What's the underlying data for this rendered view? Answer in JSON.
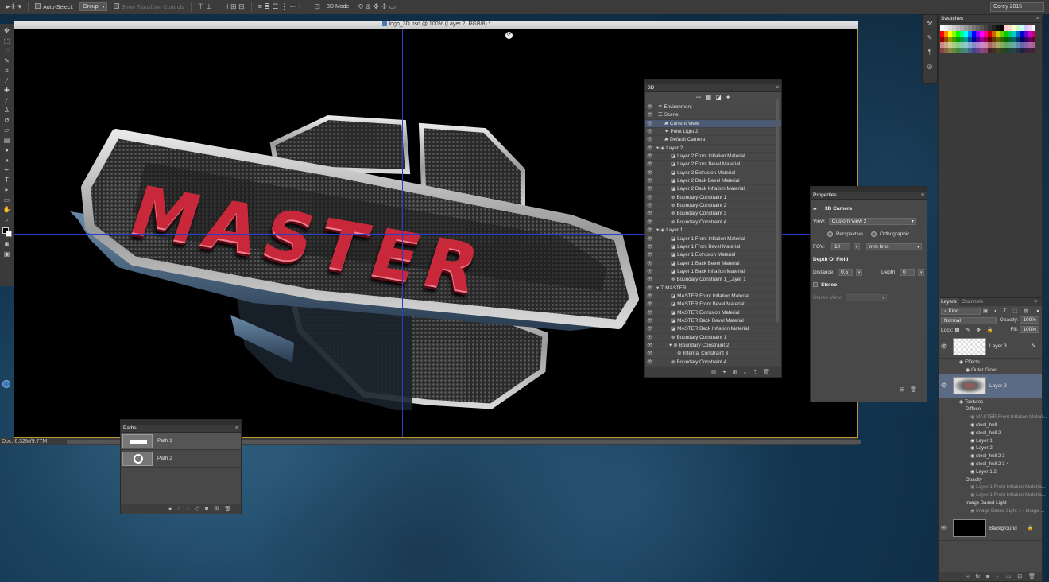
{
  "options_bar": {
    "auto_select_label": "Auto-Select:",
    "auto_select_value": "Group",
    "transform_controls_label": "Show Transform Controls",
    "mode_3d_label": "3D Mode:",
    "workspace": "Corey 2015"
  },
  "document": {
    "tab_title": "logo_3D.psd @ 100% (Layer 2, RGB/8) *",
    "logo_text": "MASTER",
    "status_doc": "Doc: 6.32M/9.77M"
  },
  "panel_3d": {
    "title": "3D",
    "rows": [
      {
        "label": "Environment",
        "indent": 0,
        "glyph": "✲",
        "twisty": ""
      },
      {
        "label": "Scene",
        "indent": 0,
        "glyph": "☰",
        "twisty": ""
      },
      {
        "label": "Current View",
        "indent": 1,
        "glyph": "▰",
        "twisty": "",
        "selected": true
      },
      {
        "label": "Point Light 2",
        "indent": 1,
        "glyph": "✦",
        "twisty": ""
      },
      {
        "label": "Default Camera",
        "indent": 1,
        "glyph": "▰",
        "twisty": ""
      },
      {
        "label": "Layer 2",
        "indent": 0,
        "glyph": "◈",
        "twisty": "▾"
      },
      {
        "label": "Layer 2 Front Inflation Material",
        "indent": 2,
        "glyph": "◪",
        "twisty": ""
      },
      {
        "label": "Layer 2 Front Bevel Material",
        "indent": 2,
        "glyph": "◪",
        "twisty": ""
      },
      {
        "label": "Layer 2 Extrusion Material",
        "indent": 2,
        "glyph": "◪",
        "twisty": ""
      },
      {
        "label": "Layer 2 Back Bevel Material",
        "indent": 2,
        "glyph": "◪",
        "twisty": ""
      },
      {
        "label": "Layer 2 Back Inflation Material",
        "indent": 2,
        "glyph": "◪",
        "twisty": ""
      },
      {
        "label": "Boundary Constraint 1",
        "indent": 2,
        "glyph": "⊗",
        "twisty": ""
      },
      {
        "label": "Boundary Constraint 2",
        "indent": 2,
        "glyph": "⊗",
        "twisty": ""
      },
      {
        "label": "Boundary Constraint 3",
        "indent": 2,
        "glyph": "⊗",
        "twisty": ""
      },
      {
        "label": "Boundary Constraint 4",
        "indent": 2,
        "glyph": "⊗",
        "twisty": ""
      },
      {
        "label": "Layer 1",
        "indent": 0,
        "glyph": "◈",
        "twisty": "▾"
      },
      {
        "label": "Layer 1 Front Inflation Material",
        "indent": 2,
        "glyph": "◪",
        "twisty": ""
      },
      {
        "label": "Layer 1 Front Bevel Material",
        "indent": 2,
        "glyph": "◪",
        "twisty": ""
      },
      {
        "label": "Layer 1 Extrusion Material",
        "indent": 2,
        "glyph": "◪",
        "twisty": ""
      },
      {
        "label": "Layer 1 Back Bevel Material",
        "indent": 2,
        "glyph": "◪",
        "twisty": ""
      },
      {
        "label": "Layer 1 Back Inflation Material",
        "indent": 2,
        "glyph": "◪",
        "twisty": ""
      },
      {
        "label": "Boundary Constraint 1_Layer 1",
        "indent": 2,
        "glyph": "⊗",
        "twisty": ""
      },
      {
        "label": "MASTER",
        "indent": 0,
        "glyph": "T",
        "twisty": "▾"
      },
      {
        "label": "MASTER Front Inflation Material",
        "indent": 2,
        "glyph": "◪",
        "twisty": ""
      },
      {
        "label": "MASTER Front Bevel Material",
        "indent": 2,
        "glyph": "◪",
        "twisty": ""
      },
      {
        "label": "MASTER Extrusion Material",
        "indent": 2,
        "glyph": "◪",
        "twisty": ""
      },
      {
        "label": "MASTER Back Bevel Material",
        "indent": 2,
        "glyph": "◪",
        "twisty": ""
      },
      {
        "label": "MASTER Back Inflation Material",
        "indent": 2,
        "glyph": "◪",
        "twisty": ""
      },
      {
        "label": "Boundary Constraint 1",
        "indent": 2,
        "glyph": "⊗",
        "twisty": ""
      },
      {
        "label": "Boundary Constraint 2",
        "indent": 2,
        "glyph": "⊗",
        "twisty": "▾"
      },
      {
        "label": "Internal Constraint 3",
        "indent": 3,
        "glyph": "⊗",
        "twisty": ""
      },
      {
        "label": "Boundary Constraint 4",
        "indent": 2,
        "glyph": "⊗",
        "twisty": ""
      }
    ]
  },
  "properties": {
    "title": "Properties",
    "section": "3D Camera",
    "view_label": "View:",
    "view_value": "Custom View 2",
    "perspective": "Perspective",
    "orthographic": "Orthographic",
    "fov_label": "FOV:",
    "fov_value": "10",
    "lens_value": "mm lens",
    "dof_label": "Depth Of Field",
    "distance_label": "Distance:",
    "distance_value": "0.5",
    "depth_label": "Depth:",
    "depth_value": "0",
    "stereo_label": "Stereo",
    "stereo_view_label": "Stereo View:"
  },
  "paths": {
    "title": "Paths",
    "items": [
      "Path 1",
      "Path 2"
    ]
  },
  "swatches": {
    "title": "Swatches"
  },
  "layers": {
    "tab_layers": "Layers",
    "tab_channels": "Channels",
    "filter_kind": "Kind",
    "blend_mode": "Normal",
    "opacity_label": "Opacity:",
    "opacity_value": "100%",
    "lock_label": "Lock:",
    "fill_label": "Fill:",
    "fill_value": "100%",
    "layer3": "Layer 3",
    "layer3_fx": "fx",
    "effects": "Effects",
    "outer_glow": "Outer Glow",
    "layer2": "Layer 2",
    "textures": "Textures",
    "diffuse": "Diffuse",
    "diffuse_items": [
      {
        "label": "MASTER Front Inflation Materi...",
        "dim": true
      },
      {
        "label": "steel_hull",
        "dim": false
      },
      {
        "label": "steel_hull 2",
        "dim": false
      },
      {
        "label": "Layer 1",
        "dim": false
      },
      {
        "label": "Layer 2",
        "dim": false
      },
      {
        "label": "steel_hull 2 3",
        "dim": false
      },
      {
        "label": "steel_hull 2 3 4",
        "dim": false
      },
      {
        "label": "Layer 1 2",
        "dim": false
      }
    ],
    "opacity_section": "Opacity",
    "opacity_items": [
      "Layer 1 Front Inflation Materia...",
      "Layer 1 Front Inflation Materia..."
    ],
    "ibl_section": "Image Based Light",
    "ibl_item": "Image Based Light 1 - Image ...",
    "background": "Background"
  },
  "colors": {
    "accent_blue": "#2b3cd0",
    "logo_red": "#c8283a",
    "selection": "#5b6b85"
  }
}
